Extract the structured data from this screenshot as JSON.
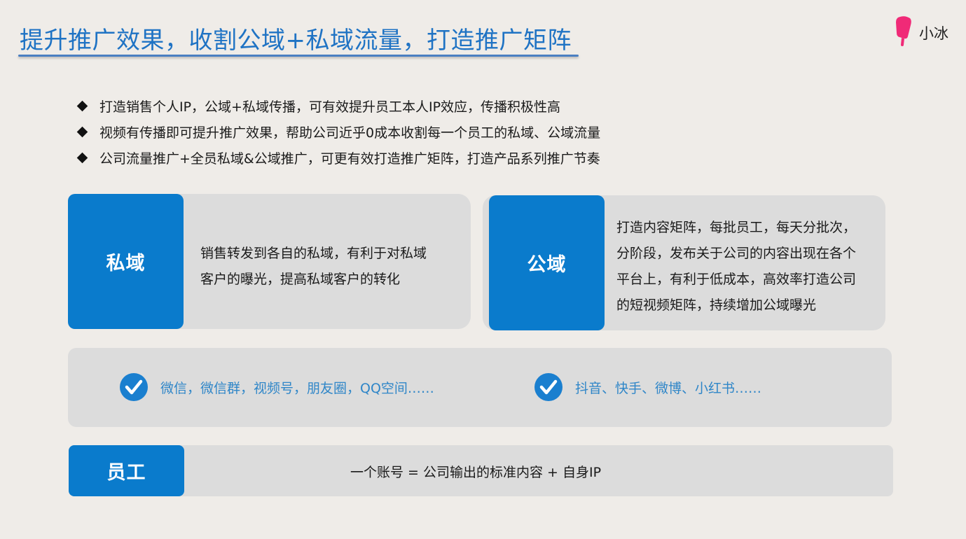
{
  "header": {
    "title": "提升推广效果，收割公域+私域流量，打造推广矩阵",
    "brand_name": "小冰",
    "brand_color": "#f02a77",
    "accent_color": "#0a7bcc"
  },
  "bullets": [
    {
      "icon": "diamond-bullet-icon",
      "text": "打造销售个人IP，公域+私域传播，可有效提升员工本人IP效应，传播积极性高"
    },
    {
      "icon": "diamond-bullet-icon",
      "text": "视频有传播即可提升推广效果，帮助公司近乎0成本收割每一个员工的私域、公域流量"
    },
    {
      "icon": "diamond-bullet-icon",
      "text": "公司流量推广+全员私域&公域推广，可更有效打造推广矩阵，打造产品系列推广节奏"
    }
  ],
  "private_domain": {
    "label": "私域",
    "lines": [
      "销售转发到各自的私域，有利于对私域",
      "客户的曝光，提高私域客户的转化"
    ]
  },
  "public_domain": {
    "label": "公域",
    "lines": [
      "打造内容矩阵，每批员工，每天分批次，",
      "分阶段，发布关于公司的内容出现在各个",
      "平台上，有利于低成本，高效率打造公司",
      "的短视频矩阵，持续增加公域曝光"
    ]
  },
  "channels": {
    "private": {
      "icon": "checkmark-icon",
      "text": "微信，微信群，视频号，朋友圈，QQ空间……"
    },
    "public": {
      "icon": "checkmark-icon",
      "text": "抖音、快手、微博、小红书……"
    }
  },
  "employee": {
    "label": "员工",
    "formula": "一个账号 = 公司输出的标准内容 + 自身IP"
  }
}
